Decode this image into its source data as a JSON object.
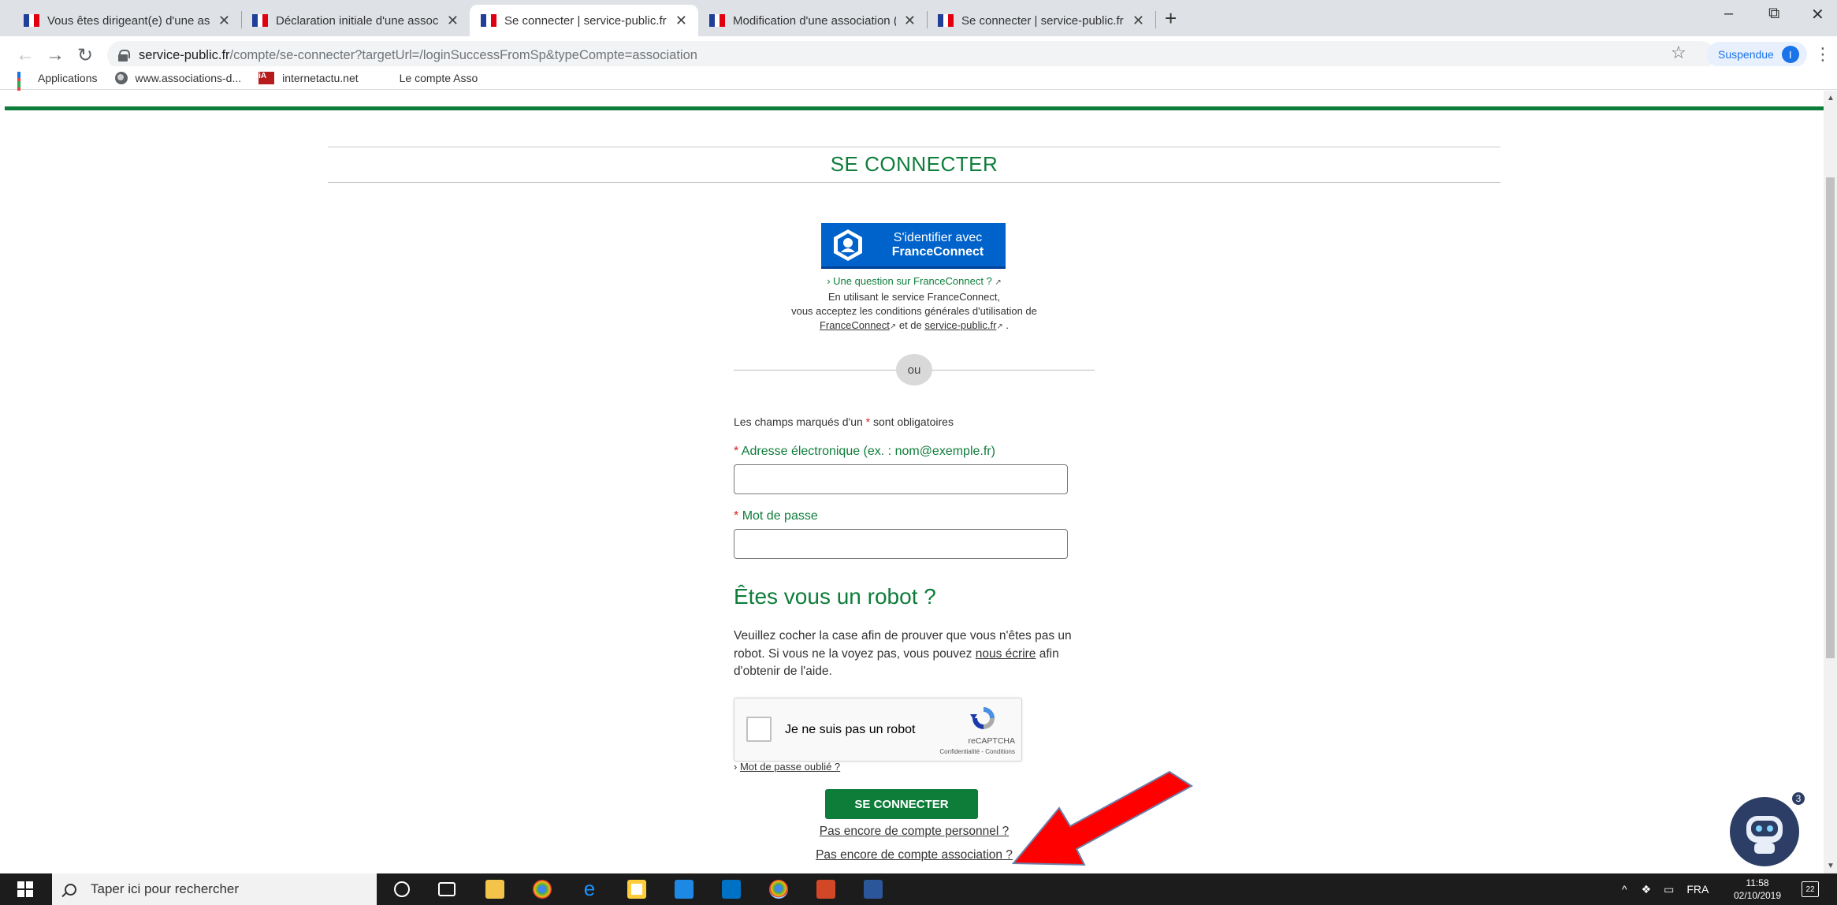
{
  "browser": {
    "tabs": [
      {
        "title": "Vous êtes dirigeant(e) d'une asso",
        "favicon": "fr-flag-icon",
        "active": false
      },
      {
        "title": "Déclaration initiale d'une associa",
        "favicon": "fr-gov-icon",
        "active": false
      },
      {
        "title": "Se connecter | service-public.fr",
        "favicon": "fr-gov-icon",
        "active": true
      },
      {
        "title": "Modification d'une association (r",
        "favicon": "fr-gov-icon",
        "active": false
      },
      {
        "title": "Se connecter | service-public.fr",
        "favicon": "fr-gov-icon",
        "active": false
      }
    ],
    "new_tab": "+",
    "window_controls": {
      "minimize": "–",
      "restore": "⧉",
      "close": "✕"
    },
    "url_host": "service-public.fr",
    "url_path": "/compte/se-connecter?targetUrl=/loginSuccessFromSp&typeCompte=association",
    "profile_label": "Suspendue",
    "profile_initial": "I",
    "bookmarks": [
      {
        "label": "Applications",
        "icon": "apps-grid-icon"
      },
      {
        "label": "www.associations-d...",
        "icon": "globe-icon"
      },
      {
        "label": "internetactu.net",
        "icon": "internetactu-icon"
      },
      {
        "label": "Le compte Asso",
        "icon": "fr-flag-icon"
      }
    ]
  },
  "page": {
    "heading": "SE CONNECTER",
    "franceconnect": {
      "button_line1": "S'identifier avec",
      "button_line2": "FranceConnect",
      "question": "Une question sur FranceConnect ?",
      "info_line1": "En utilisant le service FranceConnect,",
      "info_line2": "vous acceptez les conditions générales d'utilisation de",
      "link_fc": "FranceConnect",
      "and_text": "et de",
      "link_sp": "service-public.fr"
    },
    "separator": "ou",
    "required_note_prefix": "Les champs marqués d'un",
    "required_note_suffix": "sont obligatoires",
    "email_label": "Adresse électronique (ex. : nom@exemple.fr)",
    "email_value": "",
    "password_label": "Mot de passe",
    "password_value": "",
    "robot_title": "Êtes vous un robot ?",
    "robot_text_1": "Veuillez cocher la case afin de prouver que vous n'êtes pas un robot. Si vous ne la voyez pas, vous pouvez",
    "robot_link": "nous écrire",
    "robot_text_2": "afin d'obtenir de l'aide.",
    "captcha": {
      "label": "Je ne suis pas un robot",
      "brand": "reCAPTCHA",
      "terms": "Confidentialité - Conditions"
    },
    "forgot_password": "Mot de passe oublié ?",
    "submit": "SE CONNECTER",
    "no_personal_account": "Pas encore de compte personnel ?",
    "no_association_account": "Pas encore de compte association ?",
    "chatbot_badge": "3"
  },
  "taskbar": {
    "search_placeholder": "Taper ici pour rechercher",
    "language": "FRA",
    "time": "11:58",
    "date": "02/10/2019",
    "notifications": "22"
  },
  "colors": {
    "accent_green": "#0e7d3a",
    "franceconnect_blue": "#0063cb",
    "annotation_arrow": "#ff0000"
  }
}
